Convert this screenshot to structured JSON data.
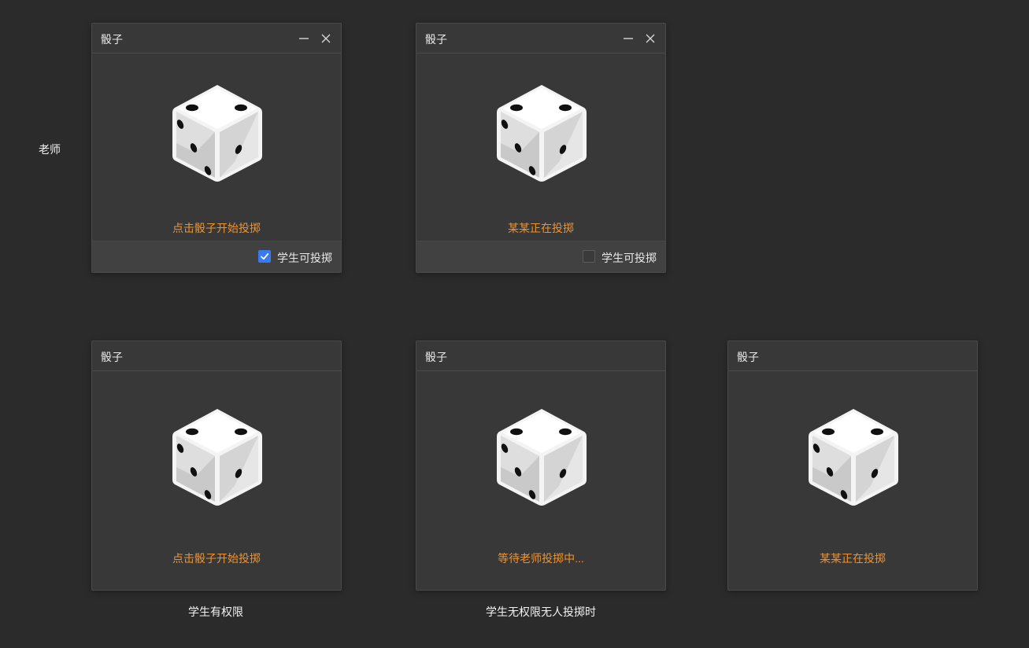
{
  "labels": {
    "teacher": "老师",
    "student_has_permission": "学生有权限",
    "student_no_permission_nobody_rolling": "学生无权限无人投掷时"
  },
  "panels": [
    {
      "title": "骰子",
      "status": "点击骰子开始投掷",
      "checkbox_label": "学生可投掷",
      "checked": true
    },
    {
      "title": "骰子",
      "status": "某某正在投掷",
      "checkbox_label": "学生可投掷",
      "checked": false
    },
    {
      "title": "骰子",
      "status": "点击骰子开始投掷"
    },
    {
      "title": "骰子",
      "status": "等待老师投掷中..."
    },
    {
      "title": "骰子",
      "status": "某某正在投掷"
    }
  ],
  "colors": {
    "background": "#2b2b2b",
    "panel": "#383838",
    "status_text": "#f0922b",
    "checkbox_accent": "#3a7af0"
  },
  "icons": [
    "minimize-icon",
    "close-icon",
    "dice-icon",
    "checkmark-icon"
  ]
}
